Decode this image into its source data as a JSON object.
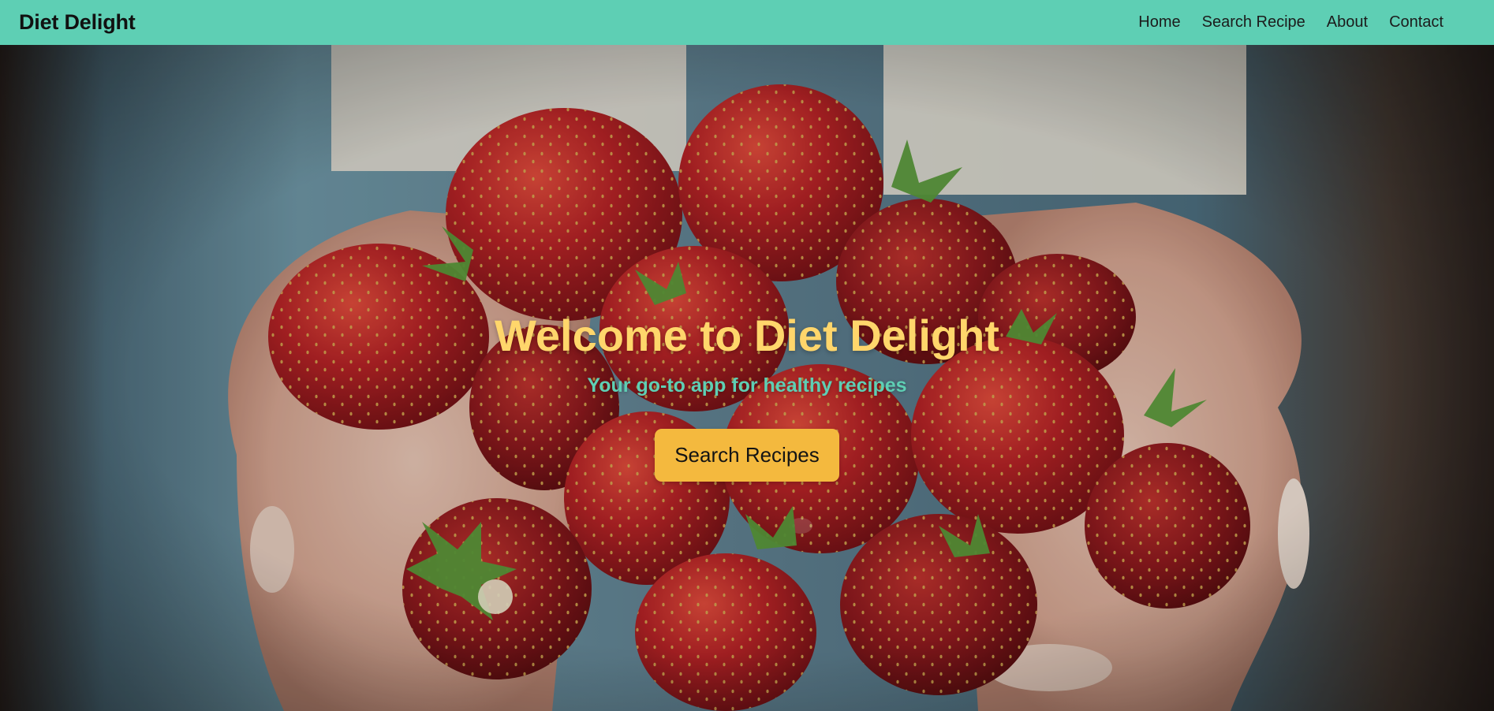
{
  "navbar": {
    "brand": "Diet Delight",
    "links": [
      "Home",
      "Search Recipe",
      "About",
      "Contact"
    ]
  },
  "hero": {
    "title": "Welcome to Diet Delight",
    "subtitle": "Your go-to app for healthy recipes",
    "cta_label": "Search Recipes",
    "background_image": "hands-holding-strawberries-photo"
  },
  "colors": {
    "nav_bg": "#5ecfb4",
    "title": "#ffd66b",
    "subtitle": "#5ecfb4",
    "button_bg": "#f4b93e"
  }
}
